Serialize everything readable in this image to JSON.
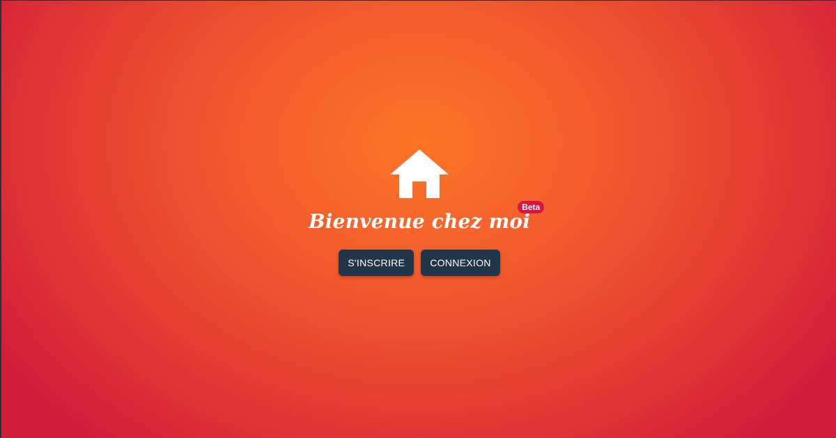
{
  "hero": {
    "icon": "home-icon",
    "title": "Bienvenue chez moi",
    "badge": "Beta"
  },
  "actions": {
    "signup_label": "S'INSCRIRE",
    "login_label": "CONNEXION"
  },
  "colors": {
    "background_center": "#fc7424",
    "background_edge": "#d31b3c",
    "button_bg": "#22364a",
    "badge_bg": "#d6163e",
    "text": "#ffffff"
  }
}
